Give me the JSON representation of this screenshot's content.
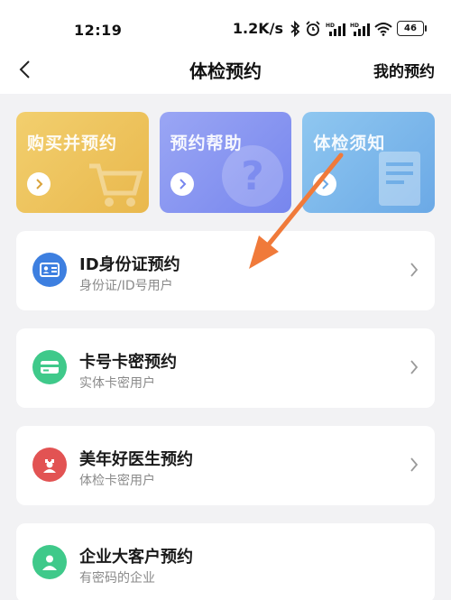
{
  "status_bar": {
    "time": "12:19",
    "speed": "1.2K/s",
    "battery": "46",
    "icons": [
      "bluetooth-icon",
      "alarm-icon",
      "signal-hd-icon",
      "signal-hd-icon",
      "wifi-icon",
      "battery-icon"
    ]
  },
  "nav": {
    "title": "体检预约",
    "action": "我的预约",
    "back_icon": "chevron-left-icon"
  },
  "cards": [
    {
      "label": "购买并预约",
      "icon": "cart-icon",
      "color": "#edc35c"
    },
    {
      "label": "预约帮助",
      "icon": "question-icon",
      "color": "#8795f1"
    },
    {
      "label": "体检须知",
      "icon": "document-icon",
      "color": "#7db8eb"
    }
  ],
  "items": [
    {
      "title": "ID身份证预约",
      "subtitle": "身份证/ID号用户",
      "icon": "id-card-icon",
      "color": "#3d7fe0"
    },
    {
      "title": "卡号卡密预约",
      "subtitle": "实体卡密用户",
      "icon": "card-icon",
      "color": "#3fc98a"
    },
    {
      "title": "美年好医生预约",
      "subtitle": "体检卡密用户",
      "icon": "doctor-icon",
      "color": "#e25353"
    },
    {
      "title": "企业大客户预约",
      "subtitle": "有密码的企业",
      "icon": "user-icon",
      "color": "#3fc98a"
    }
  ],
  "annotation_color": "#f07a3a"
}
